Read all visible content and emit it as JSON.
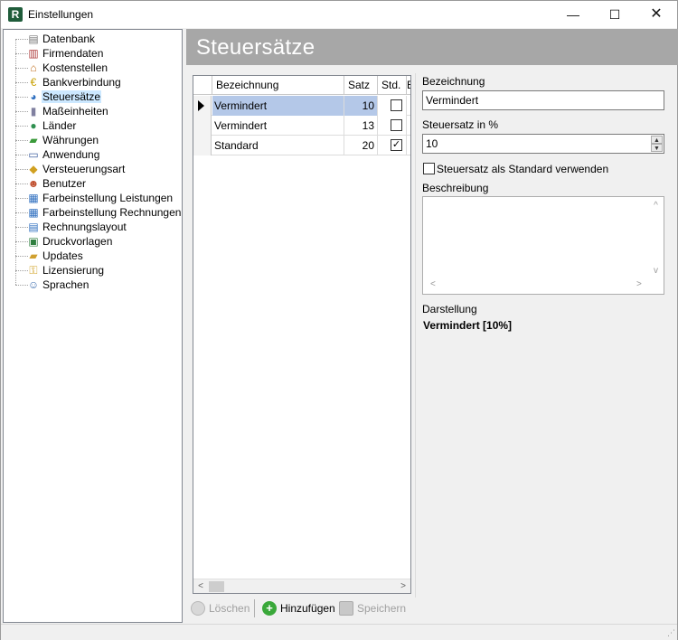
{
  "window": {
    "title": "Einstellungen",
    "minimize_glyph": "—",
    "maximize_glyph": "☐",
    "close_glyph": "✕"
  },
  "sidebar": {
    "items": [
      {
        "label": "Datenbank",
        "icon": "database-icon",
        "glyph": "▤",
        "color": "#7a7a7a"
      },
      {
        "label": "Firmendaten",
        "icon": "company-icon",
        "glyph": "▥",
        "color": "#b04040"
      },
      {
        "label": "Kostenstellen",
        "icon": "house-icon",
        "glyph": "⌂",
        "color": "#c07020"
      },
      {
        "label": "Bankverbindung",
        "icon": "euro-icon",
        "glyph": "€",
        "color": "#c8a000"
      },
      {
        "label": "Steuersätze",
        "icon": "tax-icon",
        "glyph": "◕",
        "color": "#3070c0",
        "selected": true
      },
      {
        "label": "Maßeinheiten",
        "icon": "measure-icon",
        "glyph": "▮",
        "color": "#8080a0"
      },
      {
        "label": "Länder",
        "icon": "globe-icon",
        "glyph": "●",
        "color": "#2f9050"
      },
      {
        "label": "Währungen",
        "icon": "money-icon",
        "glyph": "▰",
        "color": "#3a9a3a"
      },
      {
        "label": "Anwendung",
        "icon": "application-icon",
        "glyph": "▭",
        "color": "#4060a0"
      },
      {
        "label": "Versteuerungsart",
        "icon": "tax-type-icon",
        "glyph": "◆",
        "color": "#d0a020"
      },
      {
        "label": "Benutzer",
        "icon": "user-icon",
        "glyph": "☻",
        "color": "#c05030"
      },
      {
        "label": "Farbeinstellung Leistungen",
        "icon": "color-grid-icon",
        "glyph": "▦",
        "color": "#3070c0"
      },
      {
        "label": "Farbeinstellung Rechnungen",
        "icon": "color-grid-icon",
        "glyph": "▦",
        "color": "#3070c0"
      },
      {
        "label": "Rechnungslayout",
        "icon": "layout-icon",
        "glyph": "▤",
        "color": "#3070c0"
      },
      {
        "label": "Druckvorlagen",
        "icon": "print-template-icon",
        "glyph": "▣",
        "color": "#308040"
      },
      {
        "label": "Updates",
        "icon": "update-folder-icon",
        "glyph": "▰",
        "color": "#d0a030"
      },
      {
        "label": "Lizensierung",
        "icon": "key-icon",
        "glyph": "⚿",
        "color": "#d0a020"
      },
      {
        "label": "Sprachen",
        "icon": "language-icon",
        "glyph": "☺",
        "color": "#4070b0"
      }
    ]
  },
  "banner": {
    "title": "Steuersätze"
  },
  "grid": {
    "columns": [
      "Bezeichnung",
      "Satz",
      "Std.",
      "E"
    ],
    "rows": [
      {
        "name": "Vermindert",
        "rate": "10",
        "std": false,
        "selected": true
      },
      {
        "name": "Vermindert",
        "rate": "13",
        "std": false,
        "selected": false
      },
      {
        "name": "Standard",
        "rate": "20",
        "std": true,
        "selected": false
      }
    ],
    "check_glyph": "✓",
    "scroll_left": "<",
    "scroll_right": ">"
  },
  "form": {
    "name_label": "Bezeichnung",
    "name_value": "Vermindert",
    "rate_label": "Steuersatz in %",
    "rate_value": "10",
    "spin_up": "▲",
    "spin_down": "▼",
    "default_checkbox_label": "Steuersatz als Standard verwenden",
    "default_checked": false,
    "description_label": "Beschreibung",
    "description_value": "",
    "memo_scroll_up": "^",
    "memo_scroll_down": "v",
    "memo_scroll_left": "<",
    "memo_scroll_right": ">",
    "display_label": "Darstellung",
    "display_value": "Vermindert [10%]"
  },
  "toolbar": {
    "delete_label": "Löschen",
    "add_label": "Hinzufügen",
    "save_label": "Speichern",
    "add_icon_glyph": "+"
  },
  "status": {
    "grip_glyph": "⋰"
  }
}
